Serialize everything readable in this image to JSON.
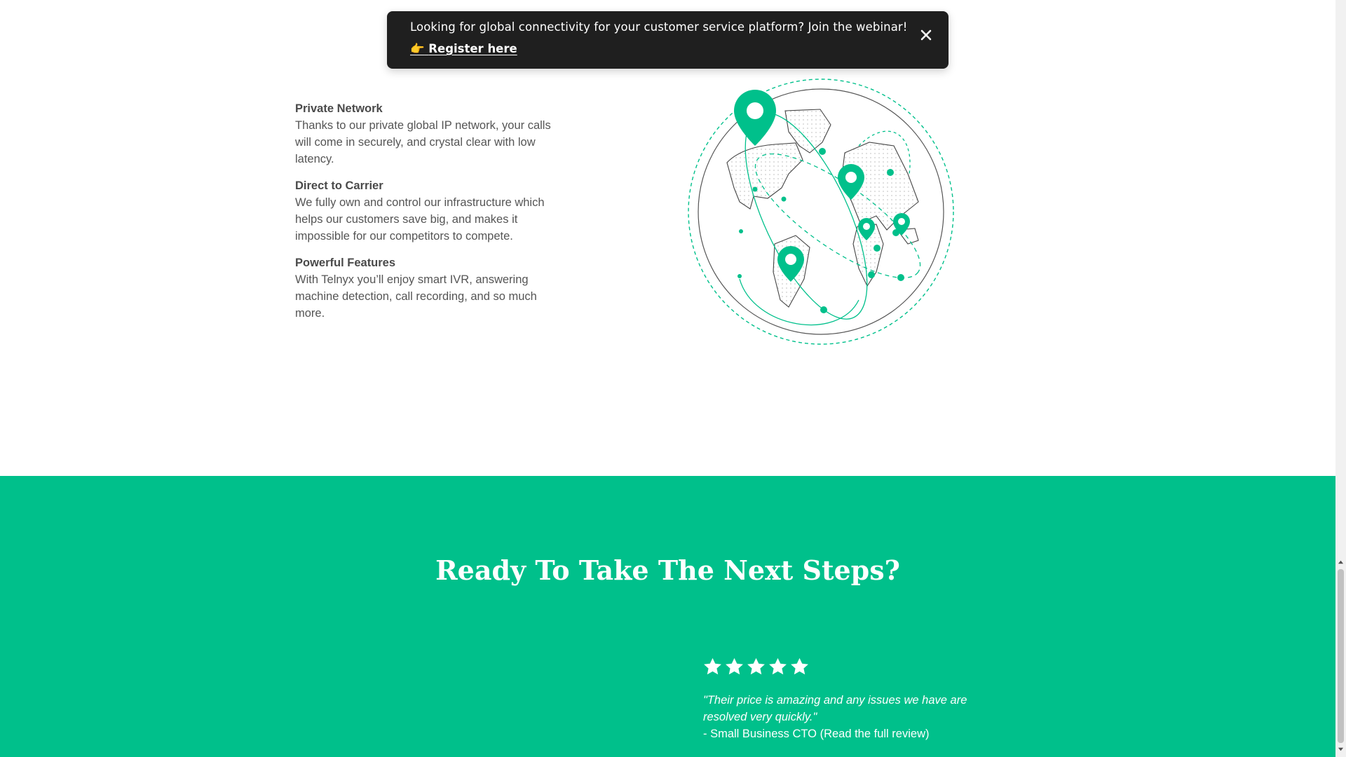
{
  "banner": {
    "message": "Looking for global connectivity for your customer service platform? Join the webinar!",
    "link_emoji": "👉",
    "link_text": "Register here",
    "close_icon": "close-icon"
  },
  "features": [
    {
      "title": "Private Network",
      "text": "Thanks to our private global IP network, your calls will come in securely, and crystal clear with low latency."
    },
    {
      "title": "Direct to Carrier",
      "text": "We fully own and control our infrastructure which helps our customers save big, and makes it impossible for our competitors to compete."
    },
    {
      "title": "Powerful Features",
      "text": "With Telnyx you’ll enjoy smart IVR, answering machine detection, call recording, and so much more."
    }
  ],
  "globe": {
    "icon": "globe-network-illustration",
    "accent": "#00c08b"
  },
  "cta": {
    "title": "Ready To Take The Next Steps?",
    "background": "#00c08b",
    "rating": 5,
    "review_quote": "\"Their price is amazing and any issues we have are resolved very quickly.\"",
    "review_author": "- Small Business CTO ",
    "review_link": "(Read the full review)"
  }
}
